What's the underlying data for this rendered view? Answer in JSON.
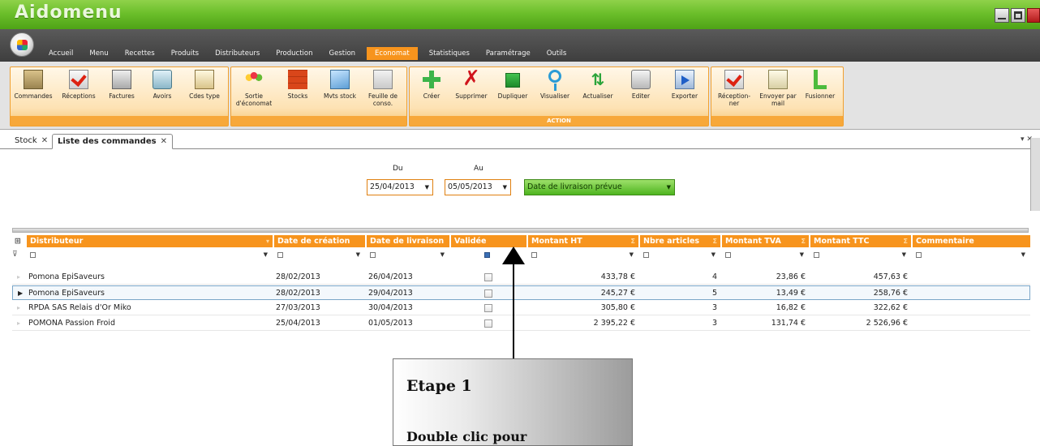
{
  "app": {
    "title": "Aidomenu"
  },
  "menubar": {
    "tabs": [
      "Accueil",
      "Menu",
      "Recettes",
      "Produits",
      "Distributeurs",
      "Production",
      "Gestion",
      "Economat",
      "Statistiques",
      "Paramétrage",
      "Outils"
    ],
    "active": "Economat"
  },
  "ribbon": {
    "group1": {
      "buttons": [
        "Commandes",
        "Réceptions",
        "Factures",
        "Avoirs",
        "Cdes type"
      ]
    },
    "group2": {
      "buttons": [
        "Sortie d'économat",
        "Stocks",
        "Mvts stock",
        "Feuille de conso."
      ]
    },
    "group3": {
      "buttons": [
        "Créer",
        "Supprimer",
        "Dupliquer",
        "Visualiser",
        "Actualiser",
        "Editer",
        "Exporter"
      ],
      "footer": "ACTION"
    },
    "group4": {
      "buttons": [
        "Réception-ner",
        "Envoyer par mail",
        "Fusionner"
      ]
    }
  },
  "doctabs": [
    {
      "label": "Stock",
      "active": false
    },
    {
      "label": "Liste des commandes",
      "active": true
    }
  ],
  "filters": {
    "du_label": "Du",
    "au_label": "Au",
    "du_value": "25/04/2013",
    "au_value": "05/05/2013",
    "date_type": "Date de livraison prévue"
  },
  "grid": {
    "columns": [
      "Distributeur",
      "Date de création",
      "Date de livraison",
      "Validée",
      "Montant HT",
      "Nbre articles",
      "Montant TVA",
      "Montant TTC",
      "Commentaire"
    ],
    "rows": [
      {
        "distributeur": "Pomona EpiSaveurs",
        "creation": "28/02/2013",
        "livraison": "26/04/2013",
        "ht": "433,78 €",
        "nb": "4",
        "tva": "23,86 €",
        "ttc": "457,63 €"
      },
      {
        "distributeur": "Pomona EpiSaveurs",
        "creation": "28/02/2013",
        "livraison": "29/04/2013",
        "ht": "245,27 €",
        "nb": "5",
        "tva": "13,49 €",
        "ttc": "258,76 €"
      },
      {
        "distributeur": "RPDA SAS Relais d'Or Miko",
        "creation": "27/03/2013",
        "livraison": "30/04/2013",
        "ht": "305,80 €",
        "nb": "3",
        "tva": "16,82 €",
        "ttc": "322,62 €"
      },
      {
        "distributeur": "POMONA Passion Froid",
        "creation": "25/04/2013",
        "livraison": "01/05/2013",
        "ht": "2 395,22 €",
        "nb": "3",
        "tva": "131,74 €",
        "ttc": "2 526,96 €"
      }
    ]
  },
  "annotation": {
    "title": "Etape 1",
    "text": "Double clic pour"
  },
  "colors": {
    "accent": "#f7941d",
    "titlebar": "#6cbf2b",
    "menubar": "#4a4a4a"
  }
}
